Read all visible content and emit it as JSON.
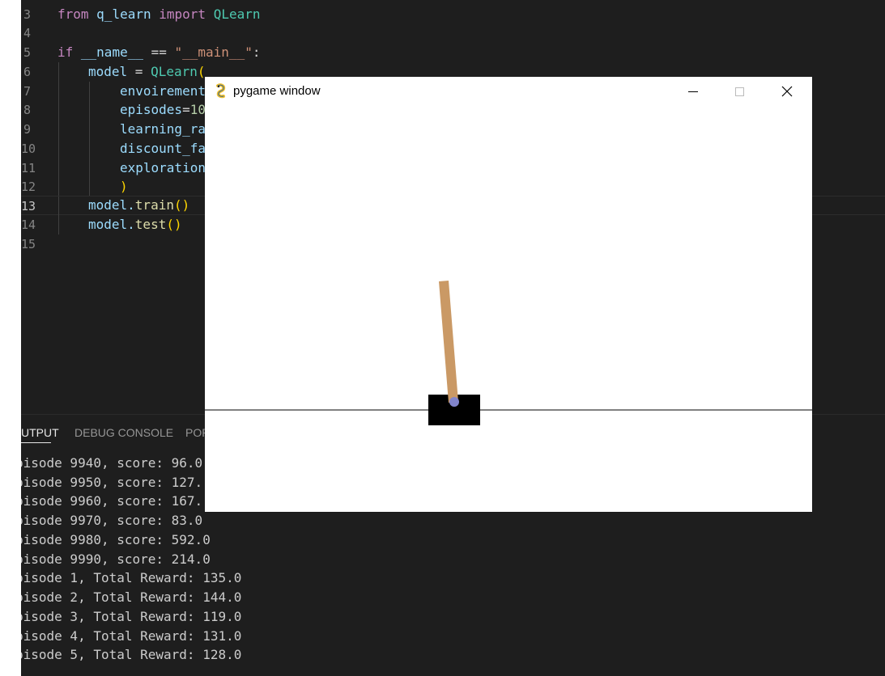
{
  "editor": {
    "lines": [
      {
        "num": "3",
        "current": false
      },
      {
        "num": "4",
        "current": false
      },
      {
        "num": "5",
        "current": false
      },
      {
        "num": "6",
        "current": false
      },
      {
        "num": "7",
        "current": false
      },
      {
        "num": "8",
        "current": false
      },
      {
        "num": "9",
        "current": false
      },
      {
        "num": "10",
        "current": false
      },
      {
        "num": "11",
        "current": false
      },
      {
        "num": "12",
        "current": false
      },
      {
        "num": "13",
        "current": true
      },
      {
        "num": "14",
        "current": false
      },
      {
        "num": "15",
        "current": false
      }
    ],
    "tokens": {
      "from": "from",
      "module": "q_learn",
      "import": "import",
      "qlearn": "QLearn",
      "if": "if",
      "dunder_name": "__name__",
      "eq": " == ",
      "main_str": "\"__main__\"",
      "colon": ":",
      "model": "model",
      "assign": " = ",
      "qlearn_call": "QLearn",
      "open_paren": "(",
      "envoirement": "envoirement",
      "episodes": "episodes",
      "episodes_eq": "=",
      "episodes_val": "10",
      "learning_rate": "learning_ra",
      "discount_factor": "discount_fa",
      "exploration": "exploration",
      "close_paren": ")",
      "model_train": "model.",
      "train_fn": "train",
      "train_parens": "()",
      "model_test": "model.",
      "test_fn": "test",
      "test_parens": "()"
    }
  },
  "panel": {
    "tabs": [
      {
        "label": "UTPUT",
        "active": true
      },
      {
        "label": "DEBUG CONSOLE",
        "active": false
      },
      {
        "label": "POR",
        "active": false
      }
    ],
    "output": [
      "pisode 9940, score: 96.0",
      "pisode 9950, score: 127.",
      "pisode 9960, score: 167.",
      "pisode 9970, score: 83.0",
      "pisode 9980, score: 592.0",
      "pisode 9990, score: 214.0",
      "pisode 1, Total Reward: 135.0",
      "pisode 2, Total Reward: 144.0",
      "pisode 3, Total Reward: 119.0",
      "pisode 4, Total Reward: 131.0",
      "pisode 5, Total Reward: 128.0"
    ]
  },
  "pygame": {
    "title": "pygame window",
    "icon": "pygame-snake-icon",
    "controls": [
      "minimize-icon",
      "maximize-icon",
      "close-icon"
    ],
    "scene": {
      "cart_color": "#000000",
      "pole_color": "#ca9965",
      "axle_color": "#8184cb",
      "track_color": "#000000"
    }
  },
  "colors": {
    "editor_bg": "#1e1e1e",
    "line_number": "#858585",
    "keyword": "#c586c0",
    "variable": "#9cdcfe",
    "class": "#4ec9b0",
    "string": "#ce9178",
    "function": "#dcdcaa",
    "bracket": "#ffd700"
  }
}
